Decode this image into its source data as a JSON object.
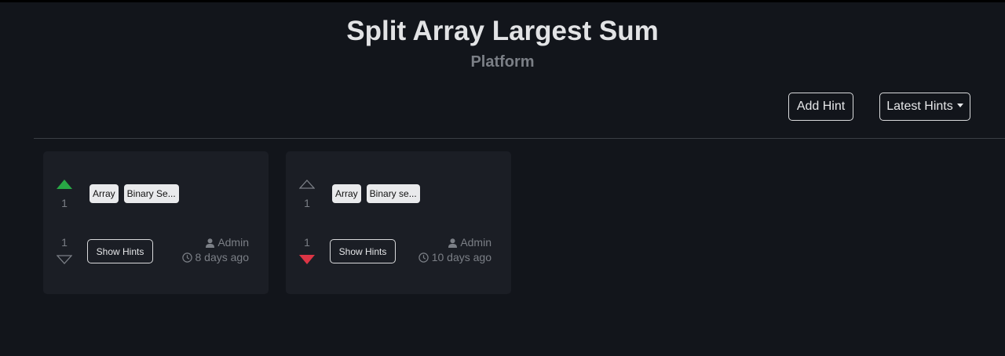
{
  "header": {
    "title": "Split Array Largest Sum",
    "subtitle": "Platform"
  },
  "toolbar": {
    "add_hint_label": "Add Hint",
    "sort_label": "Latest Hints"
  },
  "colors": {
    "background": "#12151b",
    "card": "#1b1e25",
    "upvote_active": "#28a745",
    "downvote_active": "#dc3545",
    "muted": "#7b7f86"
  },
  "hints": [
    {
      "upvotes": "1",
      "downvotes": "1",
      "user_vote": "up",
      "tags": [
        "Array",
        "Binary Se..."
      ],
      "show_hints_label": "Show Hints",
      "author": "Admin",
      "posted": "8 days ago"
    },
    {
      "upvotes": "1",
      "downvotes": "1",
      "user_vote": "down",
      "tags": [
        "Array",
        "Binary se..."
      ],
      "show_hints_label": "Show Hints",
      "author": "Admin",
      "posted": "10 days ago"
    }
  ]
}
